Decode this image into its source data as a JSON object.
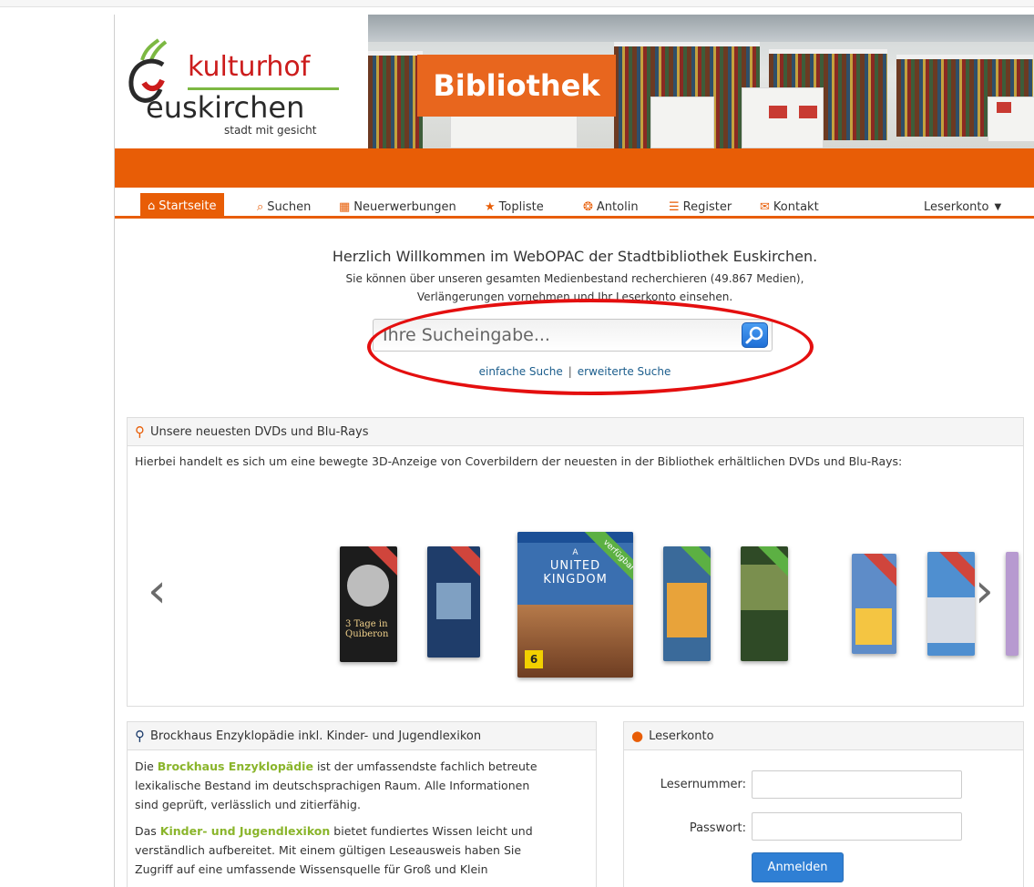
{
  "logo": {
    "name": "kulturhof",
    "city": "euskirchen",
    "tagline": "stadt mit gesicht"
  },
  "banner": {
    "title": "Bibliothek"
  },
  "nav": {
    "items": [
      {
        "label": "Startseite",
        "icon": "home-icon",
        "glyph": "⌂"
      },
      {
        "label": "Suchen",
        "icon": "search-icon",
        "glyph": "⌕"
      },
      {
        "label": "Neuerwerbungen",
        "icon": "calendar-icon",
        "glyph": "▦"
      },
      {
        "label": "Topliste",
        "icon": "star-icon",
        "glyph": "★"
      },
      {
        "label": "Antolin",
        "icon": "lifebuoy-icon",
        "glyph": "❂"
      },
      {
        "label": "Register",
        "icon": "list-icon",
        "glyph": "☰"
      },
      {
        "label": "Kontakt",
        "icon": "envelope-icon",
        "glyph": "✉"
      }
    ],
    "account": "Leserkonto"
  },
  "welcome": {
    "title": "Herzlich Willkommen im WebOPAC der Stadtbibliothek Euskirchen.",
    "line1": "Sie können über unseren gesamten Medienbestand recherchieren (49.867 Medien),",
    "line2": "Verlängerungen vornehmen und Ihr Leserkonto einsehen."
  },
  "search": {
    "placeholder": "Ihre Sucheingabe...",
    "simple": "einfache Suche",
    "separator": "|",
    "advanced": "erweiterte Suche"
  },
  "dvd": {
    "heading": "Unsere neuesten DVDs und Blu-Rays",
    "description": "Hierbei handelt es sich um eine bewegte 3D-Anzeige von Coverbildern der neuesten in der Bibliothek erhältlichen DVDs und Blu-Rays:",
    "featured": {
      "title_line1": "UNITED",
      "title_line2": "KINGDOM",
      "prefix": "A",
      "ribbon": "verfügbar",
      "rating": "6"
    },
    "covers": [
      {
        "text": "3 Tage in Quiberon",
        "color": "#1c1c1c",
        "ribbon": "#d0453c"
      },
      {
        "text": "",
        "color": "#1f3d6a",
        "ribbon": "#d0453c"
      },
      {
        "text": "",
        "color": "#3a6a9a",
        "ribbon": "#5cb043"
      },
      {
        "text": "",
        "color": "#2f4a26",
        "ribbon": "#5cb043"
      },
      {
        "text": "",
        "color": "#5e8cc8",
        "ribbon": "#d0453c"
      },
      {
        "text": "",
        "color": "#4f8fd0",
        "ribbon": "#d0453c"
      }
    ]
  },
  "brockhaus": {
    "heading": "Brockhaus Enzyklopädie inkl. Kinder- und Jugendlexikon",
    "p1_strong": "Brockhaus Enzyklopädie",
    "p1_pre": "Die",
    "p1_rest1": "ist der umfassendste fachlich betreute",
    "p1_rest2": "lexikalische Bestand im deutschsprachigen Raum. Alle Informationen",
    "p1_rest3": "sind geprüft, verlässlich und zitierfähig.",
    "p2_pre": "Das",
    "p2_strong": "Kinder- und Jugendlexikon",
    "p2_rest1": "bietet fundiertes Wissen leicht und",
    "p2_rest2": "verständlich aufbereitet. Mit einem gültigen Leseausweis haben Sie",
    "p2_rest3": "Zugriff auf eine umfassende Wissensquelle für Groß und Klein"
  },
  "account": {
    "heading": "Leserkonto",
    "user_label": "Lesernummer:",
    "pass_label": "Passwort:",
    "login": "Anmelden"
  }
}
